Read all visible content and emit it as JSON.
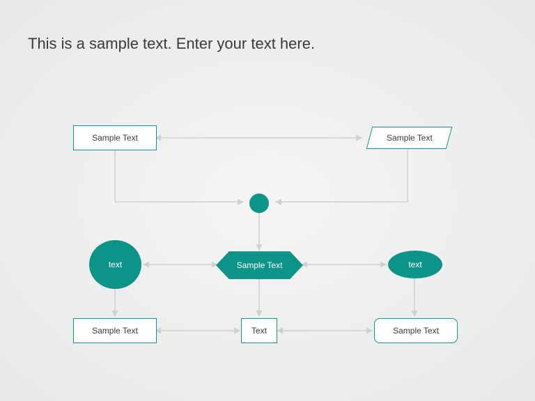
{
  "title": "This is a sample text. Enter your text here.",
  "colors": {
    "accent": "#0d9488",
    "background_start": "#f5f5f5",
    "background_end": "#e8e8e8",
    "text_body": "#3a3a3a",
    "connector": "#d0d0d0"
  },
  "nodes": {
    "top_left_rect": {
      "label": "Sample Text",
      "type": "rectangle"
    },
    "top_right_parallelogram": {
      "label": "Sample Text",
      "type": "parallelogram"
    },
    "center_circle_small": {
      "label": "",
      "type": "circle-small"
    },
    "mid_left_circle": {
      "label": "text",
      "type": "circle-large"
    },
    "mid_center_hexagon": {
      "label": "Sample Text",
      "type": "hexagon"
    },
    "mid_right_ellipse": {
      "label": "text",
      "type": "ellipse"
    },
    "bottom_left_rect": {
      "label": "Sample Text",
      "type": "rectangle"
    },
    "bottom_center_rect": {
      "label": "Text",
      "type": "rectangle"
    },
    "bottom_right_rounded": {
      "label": "Sample Text",
      "type": "rounded-rectangle"
    }
  },
  "connectors": [
    {
      "from": "top_left_rect",
      "to": "top_right_parallelogram",
      "bidirectional": true
    },
    {
      "from": "top_left_rect",
      "to": "center_circle_small",
      "path": "elbow"
    },
    {
      "from": "top_right_parallelogram",
      "to": "center_circle_small",
      "path": "elbow"
    },
    {
      "from": "center_circle_small",
      "to": "mid_center_hexagon"
    },
    {
      "from": "mid_center_hexagon",
      "to": "mid_left_circle",
      "bidirectional": true
    },
    {
      "from": "mid_center_hexagon",
      "to": "mid_right_ellipse",
      "bidirectional": true
    },
    {
      "from": "mid_left_circle",
      "to": "bottom_left_rect"
    },
    {
      "from": "mid_center_hexagon",
      "to": "bottom_center_rect"
    },
    {
      "from": "mid_right_ellipse",
      "to": "bottom_right_rounded"
    },
    {
      "from": "bottom_left_rect",
      "to": "bottom_center_rect",
      "bidirectional": true
    },
    {
      "from": "bottom_center_rect",
      "to": "bottom_right_rounded",
      "bidirectional": true
    }
  ]
}
